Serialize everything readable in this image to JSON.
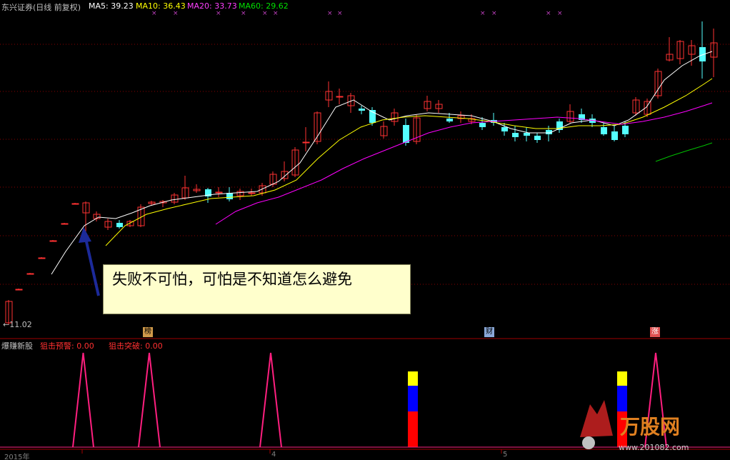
{
  "header": {
    "title": "东兴证券(日线 前复权)",
    "ma5": "MA5: 39.23",
    "ma10": "MA10: 36.43",
    "ma20": "MA20: 33.73",
    "ma60": "MA60: 29.62"
  },
  "price_panel": {
    "low_marker": "←11.02",
    "annotation": "失败不可怕，可怕是不知道怎么避免",
    "event_tags": [
      {
        "text": "榜",
        "color": "#d09a4a"
      },
      {
        "text": "财",
        "color": "#8aa8d8"
      },
      {
        "text": "涨",
        "color": "#e05050"
      }
    ]
  },
  "indicator_panel": {
    "name": "爆赚新股",
    "line1": "狙击预警: 0.00",
    "line2": "狙击突破: 0.00"
  },
  "x_axis": {
    "labels": [
      "2015年",
      "4",
      "5"
    ]
  },
  "watermark": {
    "brand": "万股网",
    "url": "www.201082.com"
  },
  "colors": {
    "up": "#ff3232",
    "down": "#54ffff",
    "ma5": "#ffffff",
    "ma10": "#ffff00",
    "ma20": "#ff00ff",
    "ma60": "#00c000",
    "indicator": "#ff1f7f",
    "grid": "#8b0000"
  }
}
